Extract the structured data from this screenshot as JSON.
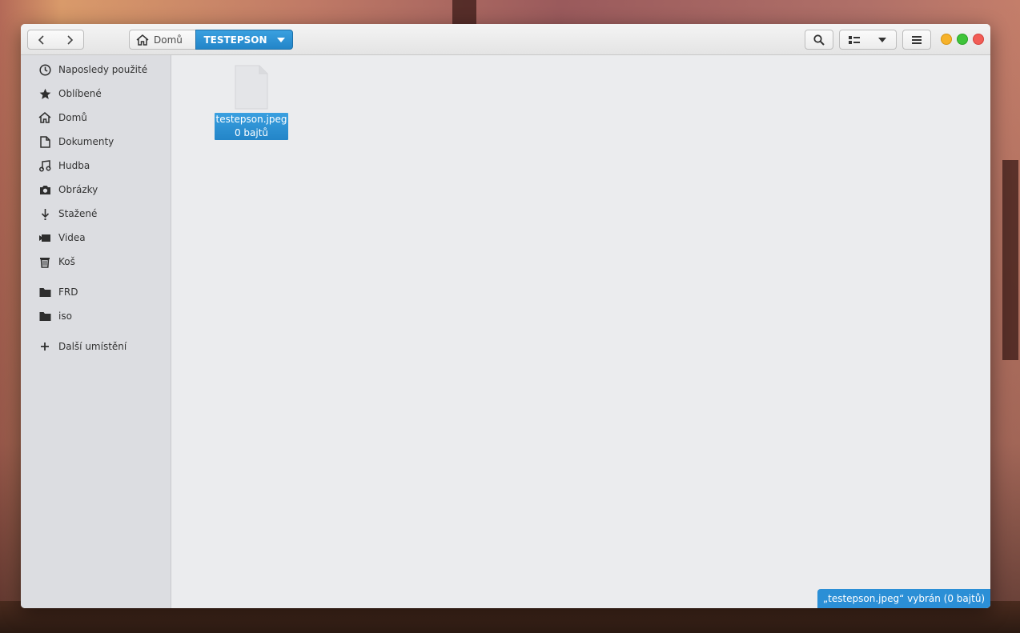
{
  "toolbar": {
    "back_icon": "chevron-left-icon",
    "forward_icon": "chevron-right-icon",
    "path_home_label": "Domů",
    "path_current_label": "TESTEPSON",
    "search_icon": "search-icon",
    "view_icon": "grid-view-icon",
    "view_dropdown_icon": "caret-down-icon",
    "menu_icon": "hamburger-menu-icon"
  },
  "window_controls": {
    "minimize_color": "#f6b22a",
    "maximize_color": "#3fc43a",
    "close_color": "#f25d56"
  },
  "sidebar": {
    "items": [
      {
        "label": "Naposledy použité",
        "icon": "clock-icon"
      },
      {
        "label": "Oblíbené",
        "icon": "star-icon"
      },
      {
        "label": "Domů",
        "icon": "home-icon"
      },
      {
        "label": "Dokumenty",
        "icon": "document-icon"
      },
      {
        "label": "Hudba",
        "icon": "music-icon"
      },
      {
        "label": "Obrázky",
        "icon": "camera-icon"
      },
      {
        "label": "Stažené",
        "icon": "download-icon"
      },
      {
        "label": "Videa",
        "icon": "video-icon"
      },
      {
        "label": "Koš",
        "icon": "trash-icon"
      }
    ],
    "bookmarks": [
      {
        "label": "FRD",
        "icon": "folder-icon"
      },
      {
        "label": "iso",
        "icon": "folder-icon"
      }
    ],
    "other_locations": {
      "label": "Další umístění",
      "icon": "plus-icon"
    }
  },
  "content": {
    "files": [
      {
        "name": "testepson.jpeg",
        "size": "0 bajtů",
        "icon": "file-icon",
        "selected": true
      }
    ]
  },
  "statusbar": {
    "text": "„testepson.jpeg“ vybrán  (0 bajtů)"
  },
  "colors": {
    "accent": "#2b8fd6",
    "sidebar_bg": "#dcdde1",
    "content_bg": "#ebecee"
  }
}
